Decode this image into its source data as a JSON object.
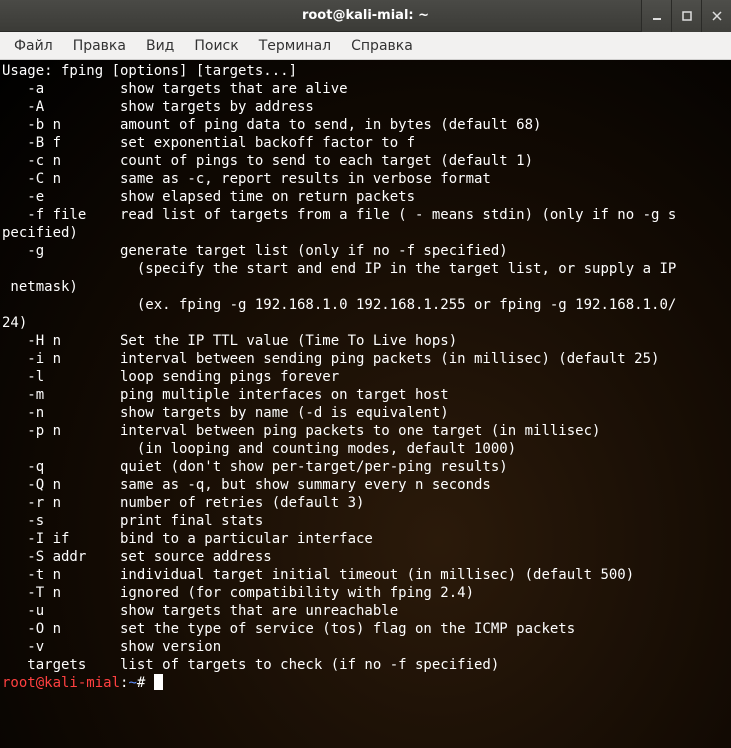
{
  "titlebar": {
    "title": "root@kali-mial: ~"
  },
  "menubar": {
    "items": [
      {
        "label": "Файл"
      },
      {
        "label": "Правка"
      },
      {
        "label": "Вид"
      },
      {
        "label": "Поиск"
      },
      {
        "label": "Терминал"
      },
      {
        "label": "Справка"
      }
    ]
  },
  "terminal": {
    "lines": [
      "Usage: fping [options] [targets...]",
      "   -a         show targets that are alive",
      "   -A         show targets by address",
      "   -b n       amount of ping data to send, in bytes (default 68)",
      "   -B f       set exponential backoff factor to f",
      "   -c n       count of pings to send to each target (default 1)",
      "   -C n       same as -c, report results in verbose format",
      "   -e         show elapsed time on return packets",
      "   -f file    read list of targets from a file ( - means stdin) (only if no -g s",
      "pecified)",
      "   -g         generate target list (only if no -f specified)",
      "                (specify the start and end IP in the target list, or supply a IP",
      " netmask)",
      "                (ex. fping -g 192.168.1.0 192.168.1.255 or fping -g 192.168.1.0/",
      "24)",
      "   -H n       Set the IP TTL value (Time To Live hops)",
      "   -i n       interval between sending ping packets (in millisec) (default 25)",
      "   -l         loop sending pings forever",
      "   -m         ping multiple interfaces on target host",
      "   -n         show targets by name (-d is equivalent)",
      "   -p n       interval between ping packets to one target (in millisec)",
      "                (in looping and counting modes, default 1000)",
      "   -q         quiet (don't show per-target/per-ping results)",
      "   -Q n       same as -q, but show summary every n seconds",
      "   -r n       number of retries (default 3)",
      "   -s         print final stats",
      "   -I if      bind to a particular interface",
      "   -S addr    set source address",
      "   -t n       individual target initial timeout (in millisec) (default 500)",
      "   -T n       ignored (for compatibility with fping 2.4)",
      "   -u         show targets that are unreachable",
      "   -O n       set the type of service (tos) flag on the ICMP packets",
      "   -v         show version",
      "   targets    list of targets to check (if no -f specified)",
      ""
    ],
    "prompt": {
      "user_host": "root@kali-mial",
      "colon": ":",
      "path": "~",
      "hash": "# "
    }
  }
}
